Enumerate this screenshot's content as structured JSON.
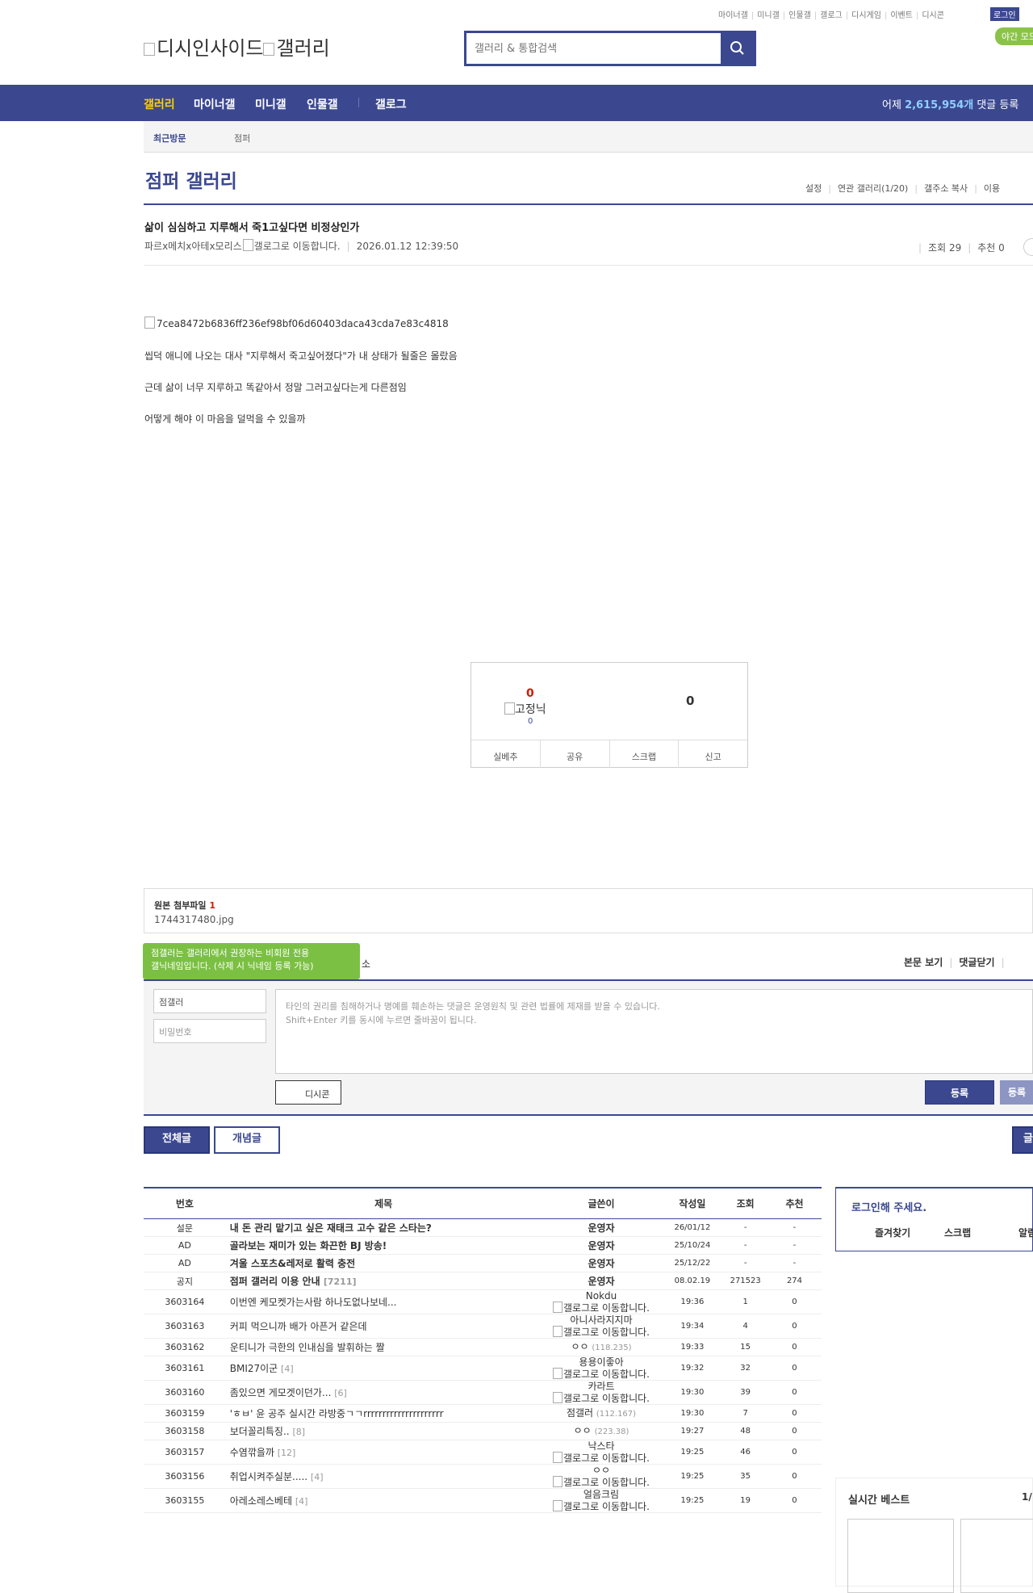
{
  "topmenu": [
    "마이너갤",
    "미니갤",
    "인물갤",
    "갤로그",
    "디시게임",
    "이벤트",
    "디시콘"
  ],
  "login_label": "로그인",
  "night_label": "야간 모드",
  "logo": {
    "site": "디시인사이드",
    "gallery": "갤러리"
  },
  "search": {
    "placeholder": "갤러리 & 통합검색"
  },
  "gnb": {
    "items": [
      "갤러리",
      "마이너갤",
      "미니갤",
      "인물갤",
      "갤로그"
    ],
    "yesterday_prefix": "어제 ",
    "yesterday_count": "2,615,954개",
    "yesterday_suffix": " 댓글 등록"
  },
  "recent": {
    "label": "최근방문",
    "gallery": "점퍼"
  },
  "gallery": {
    "title": "점퍼 갤러리",
    "util": [
      "설정",
      "연관 갤러리(1/20)",
      "갤주소 복사",
      "이용"
    ]
  },
  "post": {
    "title": "삶이 심심하고 지루해서 죽1고싶다면 비정상인가",
    "writer": "파르x메치x아테x모리스",
    "writer_img_alt": "갤로그로 이동합니다.",
    "date": "2026.01.12 12:39:50",
    "views": "조회 29",
    "recommends": "추천 0",
    "image_alt": "7cea8472b6836ff236ef98bf06d60403daca43cda7e83c4818",
    "lines": [
      "씹덕 애니에 나오는 대사 \"지루해서 죽고싶어졌다\"가 내 상태가 될줄은 몰랐음",
      "근데 삶이 너무 지루하고 똑같아서 정말 그러고싶다는게 다른점임",
      "어떻게 해야 이 마음을 덜먹을 수 있을까"
    ]
  },
  "recommend": {
    "up": "0",
    "up_img_alt": "고정닉",
    "fixed_count": "0",
    "down": "0",
    "buttons": [
      "실베추",
      "공유",
      "스크랩",
      "신고"
    ]
  },
  "attachment": {
    "label": "원본 첨부파일 ",
    "count": "1",
    "file": "1744317480.jpg"
  },
  "comment": {
    "tooltip_line1": "점갤러는 갤러리에서 권장하는 비회원 전용",
    "tooltip_line2": "갤닉네임입니다. (삭제 시 닉네임 등록 가능)",
    "tooltip_trailing": "소",
    "links": [
      "본문 보기",
      "댓글닫기"
    ],
    "nick": "점갤러",
    "password_placeholder": "비밀번호",
    "textarea_line1": "타인의 권리를 침해하거나 명예를 훼손하는 댓글은 운영원칙 및 관련 법률에 제재를 받을 수 있습니다.",
    "textarea_line2": "Shift+Enter 키를 동시에 누르면 줄바꿈이 됩니다.",
    "dccon": "디시콘",
    "submit": "등록",
    "submit2": "등록"
  },
  "tabs": {
    "all": "전체글",
    "concept": "개념글",
    "edge": "글"
  },
  "list": {
    "headers": [
      "번호",
      "제목",
      "글쓴이",
      "작성일",
      "조회",
      "추천"
    ],
    "notices": [
      {
        "num": "설문",
        "title": "내 돈 관리 맡기고 싶은 재태크 고수 같은 스타는?",
        "cnt": "",
        "writer": "운영자",
        "date": "26/01/12",
        "views": "-",
        "rec": "-"
      },
      {
        "num": "AD",
        "title": "골라보는 재미가 있는 화끈한 BJ 방송!",
        "cnt": "",
        "writer": "운영자",
        "date": "25/10/24",
        "views": "-",
        "rec": "-"
      },
      {
        "num": "AD",
        "title": "겨울 스포츠&레저로 활력 충전",
        "cnt": "",
        "writer": "운영자",
        "date": "25/12/22",
        "views": "-",
        "rec": "-"
      },
      {
        "num": "공지",
        "title": "점퍼 갤러리 이용 안내",
        "cnt": "[7211]",
        "writer": "운영자",
        "date": "08.02.19",
        "views": "271523",
        "rec": "274"
      }
    ],
    "rows": [
      {
        "num": "3603164",
        "title": "이번엔 케모켓가는사람 하나도없나보네...",
        "cnt": "",
        "writer": "Nokdu",
        "ip": "",
        "gallog": true,
        "date": "19:36",
        "views": "1",
        "rec": "0"
      },
      {
        "num": "3603163",
        "title": "커피 먹으니까 배가 아픈거 같은데",
        "cnt": "",
        "writer": "아니사라지지마",
        "ip": "",
        "gallog": true,
        "date": "19:34",
        "views": "4",
        "rec": "0"
      },
      {
        "num": "3603162",
        "title": "운티니가 극한의 인내심을 발휘하는 짤",
        "cnt": "",
        "writer": "ㅇㅇ",
        "ip": "(118.235)",
        "gallog": false,
        "date": "19:33",
        "views": "15",
        "rec": "0"
      },
      {
        "num": "3603161",
        "title": "BMI27이군",
        "cnt": "[4]",
        "writer": "용용이좋아",
        "ip": "",
        "gallog": true,
        "date": "19:32",
        "views": "32",
        "rec": "0"
      },
      {
        "num": "3603160",
        "title": "좀있으면 게모겟이던가...",
        "cnt": "[6]",
        "writer": "카라트",
        "ip": "",
        "gallog": true,
        "date": "19:30",
        "views": "39",
        "rec": "0"
      },
      {
        "num": "3603159",
        "title": "'ㅎㅂ' 윤 공주 실시간 라방중ㄱㄱrrrrrrrrrrrrrrrrrrrrr",
        "cnt": "",
        "writer": "점갤러",
        "ip": "(112.167)",
        "gallog": false,
        "date": "19:30",
        "views": "7",
        "rec": "0"
      },
      {
        "num": "3603158",
        "title": "보더꼴리특징..",
        "cnt": "[8]",
        "writer": "ㅇㅇ",
        "ip": "(223.38)",
        "gallog": false,
        "date": "19:27",
        "views": "48",
        "rec": "0"
      },
      {
        "num": "3603157",
        "title": "수염깎을까",
        "cnt": "[12]",
        "writer": "낙스타",
        "ip": "",
        "gallog": true,
        "date": "19:25",
        "views": "46",
        "rec": "0"
      },
      {
        "num": "3603156",
        "title": "취업시켜주실분.....",
        "cnt": "[4]",
        "writer": "ㅇㅇ",
        "ip": "",
        "gallog": true,
        "date": "19:25",
        "views": "35",
        "rec": "0"
      },
      {
        "num": "3603155",
        "title": "아레소레스베테",
        "cnt": "[4]",
        "writer": "얼음크림",
        "ip": "",
        "gallog": true,
        "date": "19:25",
        "views": "19",
        "rec": "0"
      }
    ],
    "gallog_alt": "갤로그로 이동합니다."
  },
  "sidebar": {
    "login_prompt": "로그인해 주세요.",
    "links": [
      "즐겨찾기",
      "스크랩",
      "알림"
    ],
    "best_title": "실시간 베스트",
    "best_page": "1/"
  }
}
